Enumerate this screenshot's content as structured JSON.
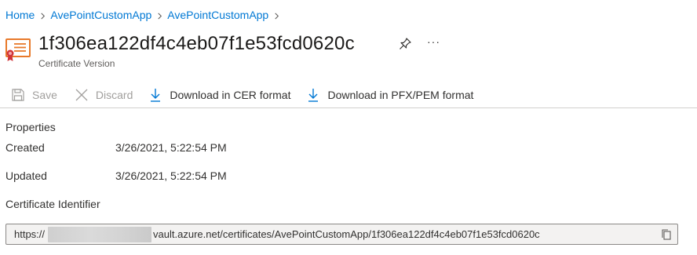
{
  "breadcrumb": {
    "items": [
      "Home",
      "AvePointCustomApp",
      "AvePointCustomApp"
    ]
  },
  "header": {
    "title": "1f306ea122df4c4eb07f1e53fcd0620c",
    "subtitle": "Certificate Version",
    "more_label": "···"
  },
  "toolbar": {
    "save_label": "Save",
    "discard_label": "Discard",
    "download_cer_label": "Download in CER format",
    "download_pfx_label": "Download in PFX/PEM format"
  },
  "properties": {
    "section_title": "Properties",
    "created_label": "Created",
    "created_value": "3/26/2021, 5:22:54 PM",
    "updated_label": "Updated",
    "updated_value": "3/26/2021, 5:22:54 PM",
    "identifier_label": "Certificate Identifier",
    "identifier_prefix": "https://",
    "identifier_suffix": "vault.azure.net/certificates/AvePointCustomApp/1f306ea122df4c4eb07f1e53fcd0620c"
  },
  "colors": {
    "link": "#0078d4",
    "cert_icon_orange": "#e8792a",
    "cert_icon_red": "#d13438"
  }
}
